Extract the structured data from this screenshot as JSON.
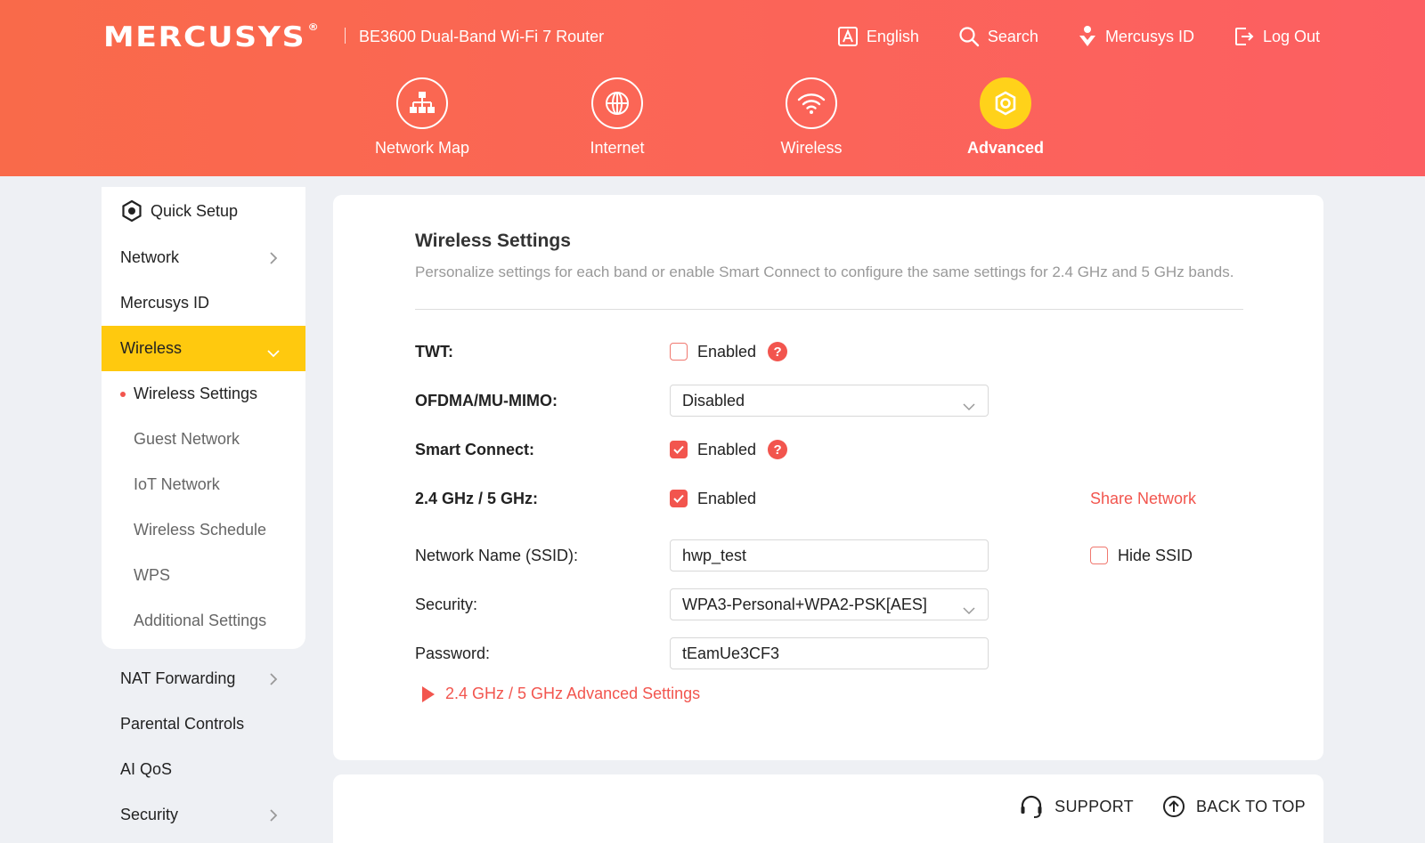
{
  "brand": {
    "logo": "MERCUSYS",
    "logo_mark": "®",
    "product": "BE3600 Dual-Band Wi-Fi 7 Router"
  },
  "top_links": {
    "language": "English",
    "search": "Search",
    "account": "Mercusys ID",
    "logout": "Log Out"
  },
  "main_nav": [
    {
      "label": "Network Map",
      "icon": "network-map-icon"
    },
    {
      "label": "Internet",
      "icon": "globe-icon"
    },
    {
      "label": "Wireless",
      "icon": "wifi-icon"
    },
    {
      "label": "Advanced",
      "icon": "gear-icon",
      "active": true
    }
  ],
  "sidebar": {
    "quick_setup": "Quick Setup",
    "network": "Network",
    "mercusys_id": "Mercusys ID",
    "wireless": "Wireless",
    "wireless_sub": [
      "Wireless Settings",
      "Guest Network",
      "IoT Network",
      "Wireless Schedule",
      "WPS",
      "Additional Settings"
    ],
    "nat_forwarding": "NAT Forwarding",
    "parental_controls": "Parental Controls",
    "ai_qos": "AI QoS",
    "security": "Security"
  },
  "main": {
    "title": "Wireless Settings",
    "description": "Personalize settings for each band or enable Smart Connect to configure the same settings for 2.4 GHz and 5 GHz bands.",
    "twt": {
      "label": "TWT:",
      "checkbox": "Enabled",
      "checked": false
    },
    "ofdma": {
      "label": "OFDMA/MU-MIMO:",
      "value": "Disabled"
    },
    "smart_connect": {
      "label": "Smart Connect:",
      "checkbox": "Enabled",
      "checked": true
    },
    "band": {
      "label": "2.4 GHz / 5 GHz:",
      "checkbox": "Enabled",
      "checked": true,
      "share": "Share Network"
    },
    "ssid": {
      "label": "Network Name (SSID):",
      "value": "hwp_test",
      "hide_label": "Hide SSID",
      "hide_checked": false
    },
    "security": {
      "label": "Security:",
      "value": "WPA3-Personal+WPA2-PSK[AES]"
    },
    "password": {
      "label": "Password:",
      "value": "tEamUe3CF3"
    },
    "advanced_link": "2.4 GHz / 5 GHz Advanced Settings",
    "help_glyph": "?"
  },
  "footer": {
    "support": "SUPPORT",
    "back_to_top": "BACK TO TOP"
  },
  "colors": {
    "header_start": "#f96a4a",
    "header_end": "#fc5f62",
    "accent": "#f2554e",
    "active_yellow": "#ffc90e"
  }
}
